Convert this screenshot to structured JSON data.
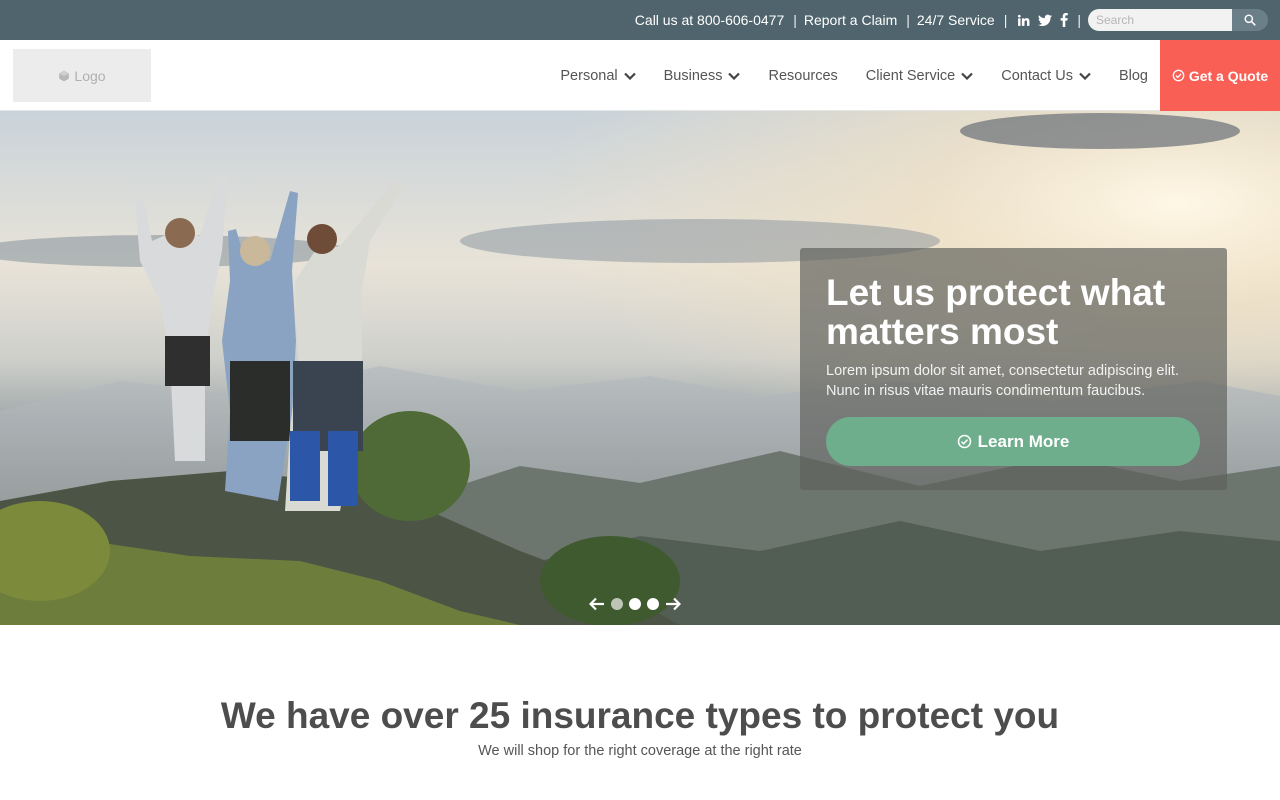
{
  "topbar": {
    "phone_text": "Call us at 800-606-0477",
    "separator": "|",
    "report_claim": "Report a Claim",
    "service": "24/7 Service",
    "social": [
      "linkedin-icon",
      "twitter-icon",
      "facebook-icon"
    ],
    "search_placeholder": "Search"
  },
  "header": {
    "logo_text": "Logo",
    "nav": [
      {
        "label": "Personal",
        "has_dropdown": true
      },
      {
        "label": "Business",
        "has_dropdown": true
      },
      {
        "label": "Resources",
        "has_dropdown": false
      },
      {
        "label": "Client Service",
        "has_dropdown": true
      },
      {
        "label": "Contact Us",
        "has_dropdown": true
      },
      {
        "label": "Blog",
        "has_dropdown": false
      }
    ],
    "quote_label": "Get a Quote"
  },
  "hero": {
    "title": "Let us protect what matters most",
    "text": "Lorem ipsum dolor sit amet, consectetur adipiscing elit. Nunc in risus vitae mauris condimentum faucibus.",
    "button_label": "Learn More",
    "slides": 3,
    "active_slide": 1
  },
  "intro": {
    "title": "We have over 25 insurance types to protect you",
    "subtitle": "We will shop for the right coverage at the right rate"
  },
  "colors": {
    "topbar_bg": "#4f646d",
    "quote_bg": "#fa5f55",
    "learn_more_bg": "#6fae8c"
  }
}
